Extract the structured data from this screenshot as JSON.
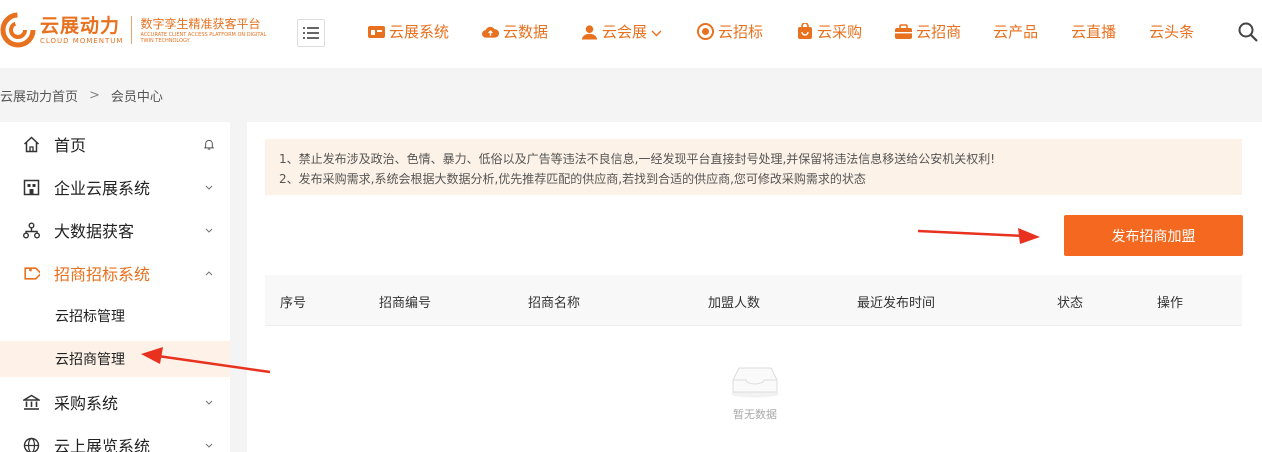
{
  "header": {
    "logo": {
      "name_cn": "云展动力",
      "name_en": "CLOUD MOMENTUM",
      "slogan_cn": "数字孪生精准获客平台",
      "slogan_en": "ACCURATE CLIENT ACCESS PLATFORM ON DIGITAL TWIN TECHNOLOGY"
    },
    "menu_icon": "list-menu-icon",
    "nav": [
      {
        "label": "云展系统",
        "icon": "exhibition-icon"
      },
      {
        "label": "云数据",
        "icon": "cloud-upload-icon"
      },
      {
        "label": "云会展",
        "icon": "users-icon",
        "has_dropdown": true
      },
      {
        "label": "云招标",
        "icon": "target-icon"
      },
      {
        "label": "云采购",
        "icon": "shopping-bag-icon"
      },
      {
        "label": "云招商",
        "icon": "briefcase-icon"
      },
      {
        "label": "云产品"
      },
      {
        "label": "云直播"
      },
      {
        "label": "云头条"
      }
    ],
    "search_icon": "search-icon"
  },
  "breadcrumb": {
    "home": "云展动力首页",
    "separator": ">",
    "current": "会员中心"
  },
  "sidebar": {
    "items": [
      {
        "label": "首页",
        "icon": "home-icon",
        "right_icon": "bell-icon"
      },
      {
        "label": "企业云展系统",
        "icon": "building-icon",
        "right_icon": "chevron-down-icon"
      },
      {
        "label": "大数据获客",
        "icon": "network-icon",
        "right_icon": "chevron-down-icon"
      },
      {
        "label": "招商招标系统",
        "icon": "tag-icon",
        "right_icon": "chevron-up-icon",
        "active": true,
        "children": [
          {
            "label": "云招标管理"
          },
          {
            "label": "云招商管理",
            "selected": true
          }
        ]
      },
      {
        "label": "采购系统",
        "icon": "bank-icon",
        "right_icon": "chevron-down-icon"
      },
      {
        "label": "云上展览系统",
        "icon": "globe-icon",
        "right_icon": "chevron-down-icon"
      }
    ]
  },
  "main": {
    "notice": [
      "1、禁止发布涉及政治、色情、暴力、低俗以及广告等违法不良信息,一经发现平台直接封号处理,并保留将违法信息移送给公安机关权利!",
      "2、发布采购需求,系统会根据大数据分析,优先推荐匹配的供应商,若找到合适的供应商,您可修改采购需求的状态"
    ],
    "publish_button": "发布招商加盟",
    "table": {
      "columns": [
        "序号",
        "招商编号",
        "招商名称",
        "加盟人数",
        "最近发布时间",
        "状态",
        "操作"
      ],
      "rows": [],
      "empty_text": "暂无数据"
    }
  },
  "colors": {
    "accent": "#e8711f",
    "button": "#f4691f",
    "annotation_arrow": "#e8321f"
  }
}
